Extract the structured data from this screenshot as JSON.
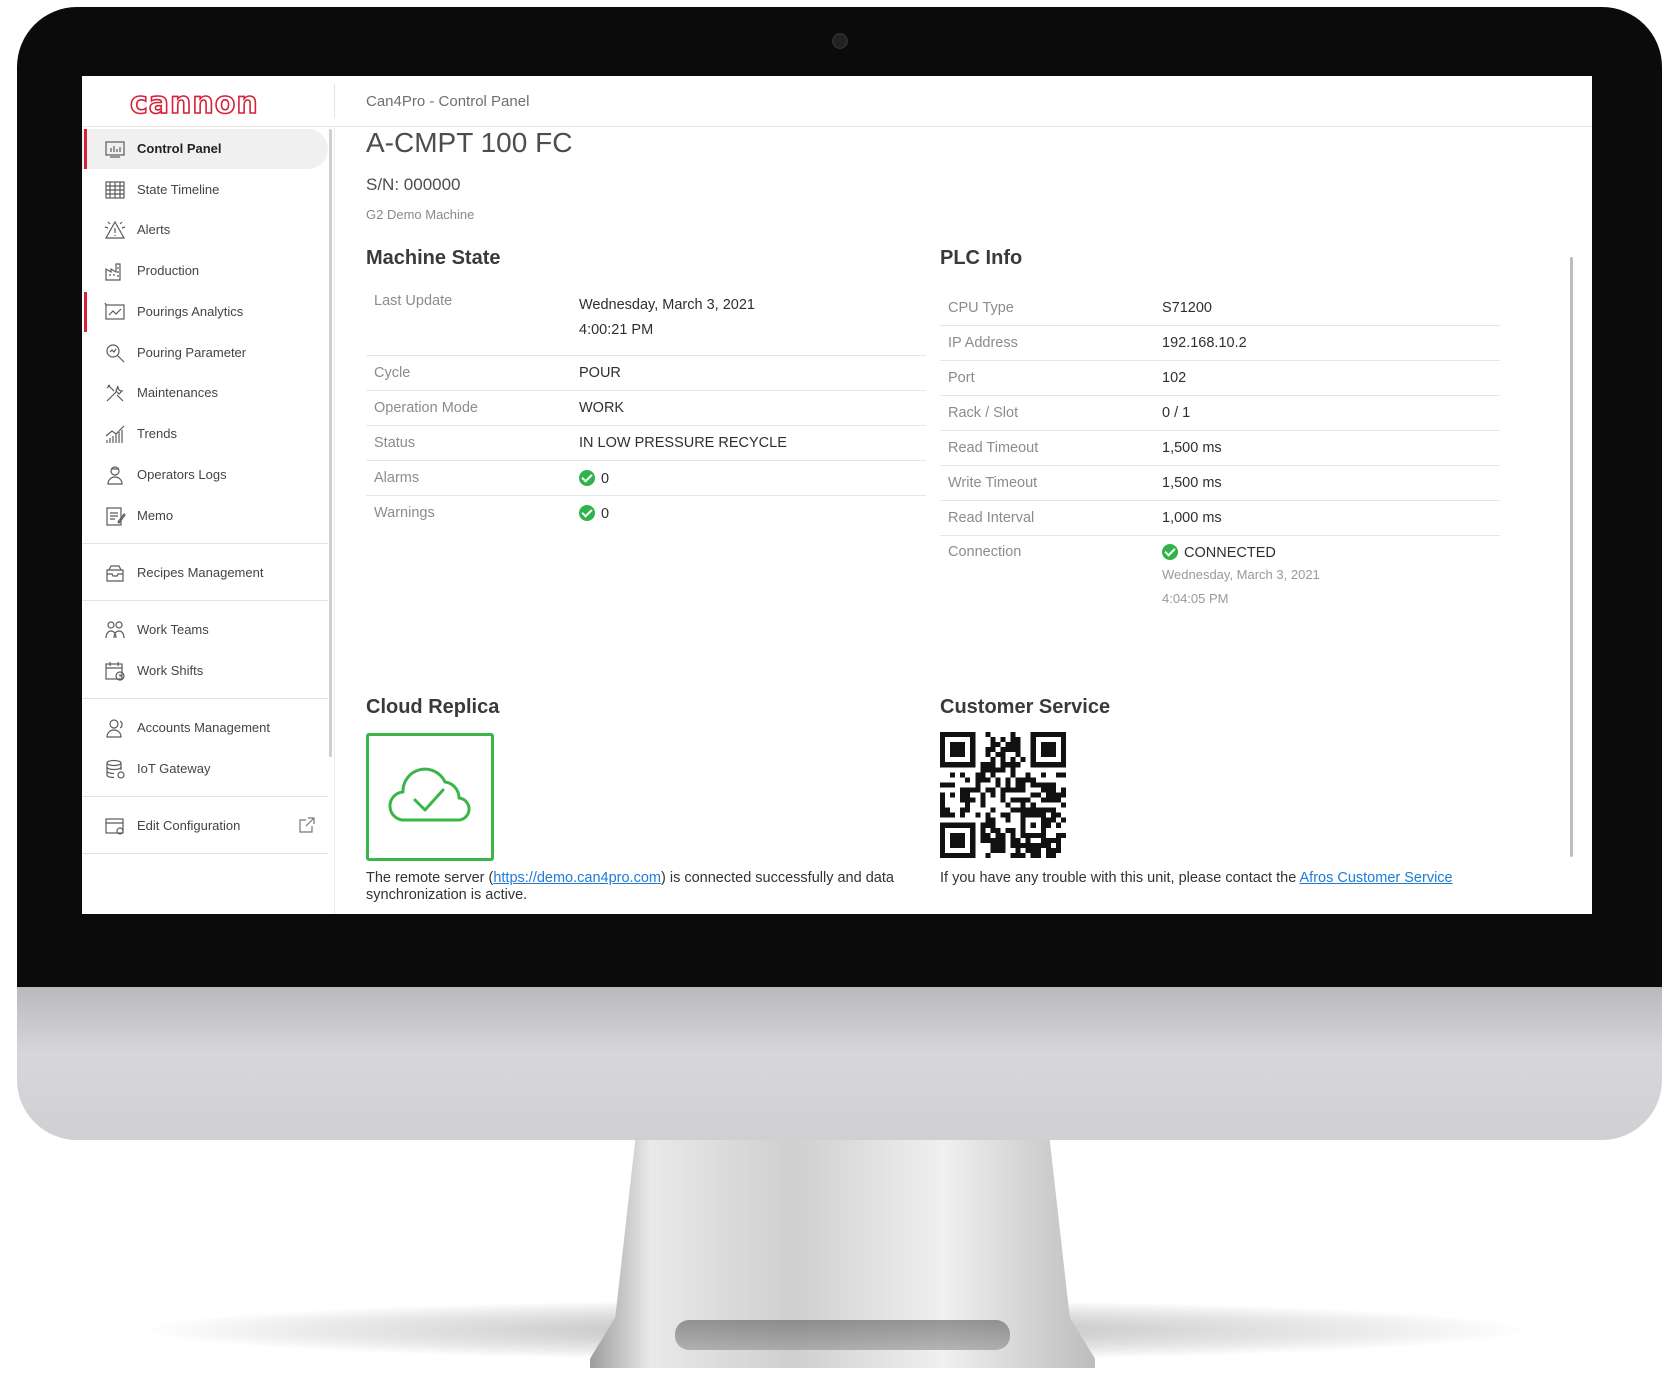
{
  "brand": {
    "logo_text": "cannon",
    "color": "#d6213a"
  },
  "header": {
    "breadcrumb": "Can4Pro - Control Panel"
  },
  "sidebar": {
    "items": [
      {
        "label": "Control Panel",
        "icon": "dashboard-icon",
        "active": true
      },
      {
        "label": "State Timeline",
        "icon": "timeline-icon"
      },
      {
        "label": "Alerts",
        "icon": "alert-icon"
      },
      {
        "label": "Production",
        "icon": "factory-icon"
      },
      {
        "label": "Pourings Analytics",
        "icon": "analytics-icon"
      },
      {
        "label": "Pouring Parameter",
        "icon": "search-chart-icon"
      },
      {
        "label": "Maintenances",
        "icon": "tools-icon"
      },
      {
        "label": "Trends",
        "icon": "trends-icon"
      },
      {
        "label": "Operators Logs",
        "icon": "operator-icon"
      },
      {
        "label": "Memo",
        "icon": "memo-icon"
      },
      {
        "label": "Recipes Management",
        "icon": "recipes-icon"
      },
      {
        "label": "Work Teams",
        "icon": "team-icon"
      },
      {
        "label": "Work Shifts",
        "icon": "calendar-icon"
      },
      {
        "label": "Accounts Management",
        "icon": "accounts-icon"
      },
      {
        "label": "IoT Gateway",
        "icon": "database-icon"
      },
      {
        "label": "Edit Configuration",
        "icon": "config-icon"
      }
    ]
  },
  "machine": {
    "name": "A-CMPT 100 FC",
    "serial": "S/N: 000000",
    "description": "G2 Demo Machine"
  },
  "machine_state": {
    "title": "Machine State",
    "last_update_label": "Last Update",
    "last_update_date": "Wednesday, March 3, 2021",
    "last_update_time": "4:00:21 PM",
    "cycle_label": "Cycle",
    "cycle": "POUR",
    "operation_mode_label": "Operation Mode",
    "operation_mode": "WORK",
    "status_label": "Status",
    "status": "IN LOW PRESSURE RECYCLE",
    "alarms_label": "Alarms",
    "alarms": "0",
    "warnings_label": "Warnings",
    "warnings": "0"
  },
  "plc_info": {
    "title": "PLC Info",
    "cpu_type_label": "CPU Type",
    "cpu_type": "S71200",
    "ip_label": "IP Address",
    "ip": "192.168.10.2",
    "port_label": "Port",
    "port": "102",
    "rack_slot_label": "Rack / Slot",
    "rack_slot": "0 / 1",
    "read_timeout_label": "Read Timeout",
    "read_timeout": "1,500 ms",
    "write_timeout_label": "Write Timeout",
    "write_timeout": "1,500 ms",
    "read_interval_label": "Read Interval",
    "read_interval": "1,000 ms",
    "connection_label": "Connection",
    "connection": "CONNECTED",
    "connection_date": "Wednesday, March 3, 2021",
    "connection_time": "4:04:05 PM"
  },
  "cloud_replica": {
    "title": "Cloud Replica",
    "text_before": "The remote server (",
    "link": "https://demo.can4pro.com",
    "text_after": ") is connected successfully and data synchronization is active."
  },
  "customer_service": {
    "title": "Customer Service",
    "text": "If you have any trouble with this unit, please contact the ",
    "link": "Afros Customer Service"
  },
  "colors": {
    "accent": "#d6213a",
    "ok": "#2fb34a",
    "cloud": "#3bb54a",
    "link": "#1e7bd6"
  }
}
